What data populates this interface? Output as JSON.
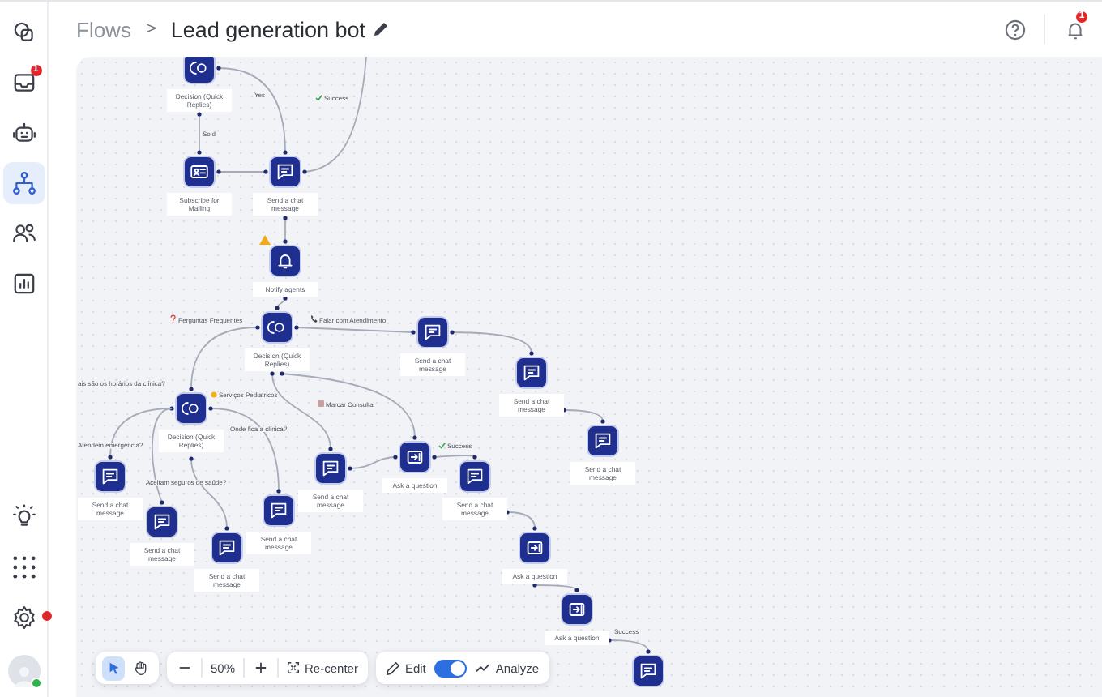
{
  "sidebar": {
    "items": [
      {
        "kind": "layers",
        "selected": false
      },
      {
        "kind": "inbox",
        "selected": false,
        "badge": "1"
      },
      {
        "kind": "bot",
        "selected": false
      },
      {
        "kind": "flows",
        "selected": true
      },
      {
        "kind": "contacts",
        "selected": false
      },
      {
        "kind": "reports",
        "selected": false
      }
    ],
    "bottom_items": [
      {
        "kind": "bulb",
        "alert": false
      },
      {
        "kind": "apps",
        "alert": false
      },
      {
        "kind": "settings",
        "alert": true
      }
    ],
    "user": {
      "online": true
    }
  },
  "header": {
    "breadcrumb": "Flows",
    "separator": ">",
    "title": "Lead generation bot",
    "notifications_badge": "1"
  },
  "flow": {
    "nodes": [
      {
        "kind": "decision",
        "label": "Decision (Quick Replies)",
        "warning": false
      },
      {
        "kind": "subscribe",
        "label": "Subscribe for Mailing",
        "warning": false
      },
      {
        "kind": "chat",
        "label": "Send a chat message",
        "warning": false
      },
      {
        "kind": "notify",
        "label": "Notify agents",
        "warning": true
      },
      {
        "kind": "decision",
        "label": "Decision (Quick Replies)",
        "warning": false
      },
      {
        "kind": "chat",
        "label": "Send a chat message",
        "warning": false
      },
      {
        "kind": "chat",
        "label": "Send a chat message",
        "warning": false
      },
      {
        "kind": "decision",
        "label": "Decision (Quick Replies)",
        "warning": false
      },
      {
        "kind": "chat",
        "label": "Send a chat message",
        "warning": false
      },
      {
        "kind": "chat",
        "label": "Send a chat message",
        "warning": false
      },
      {
        "kind": "question",
        "label": "Ask a question",
        "warning": false
      },
      {
        "kind": "chat",
        "label": "Send a chat message",
        "warning": false
      },
      {
        "kind": "chat",
        "label": "Send a chat message",
        "warning": false
      },
      {
        "kind": "chat",
        "label": "Send a chat message",
        "warning": false
      },
      {
        "kind": "chat",
        "label": "Send a chat message",
        "warning": false
      },
      {
        "kind": "chat",
        "label": "Send a chat message",
        "warning": false
      },
      {
        "kind": "question",
        "label": "Ask a question",
        "warning": false
      },
      {
        "kind": "question",
        "label": "Ask a question",
        "warning": false
      },
      {
        "kind": "chat",
        "warning": false
      }
    ],
    "edge_labels": [
      "Yes",
      "Sold",
      "Success",
      "Perguntas Frequentes",
      "Falar com Atendimento",
      "Serviços Pediatricos",
      "Marcar Consulta",
      "Success",
      "Success",
      "ais são os horários da clínica?",
      "Atendem emergência?",
      "Aceitam seguros de saúde?",
      "Onde fica a clínica?"
    ]
  },
  "toolbar": {
    "tools": [
      {
        "kind": "select",
        "selected": true
      },
      {
        "kind": "pan",
        "selected": false
      }
    ],
    "zoom": "50%",
    "recenter": "Re-center",
    "edit": "Edit",
    "analyze": "Analyze",
    "mode_toggle": {
      "on": true
    }
  }
}
